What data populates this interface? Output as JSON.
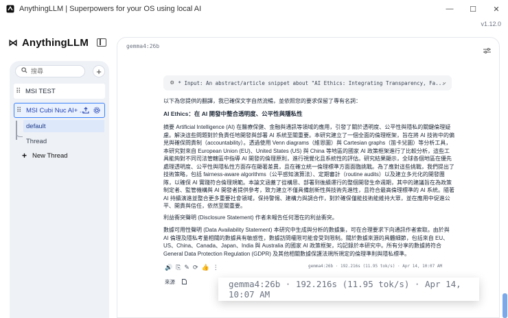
{
  "window": {
    "title": "AnythingLLM | Superpowers for your OS using local AI",
    "minimize": "—",
    "maximize": "☐",
    "close": "✕"
  },
  "version": "v1.12.0",
  "brand": {
    "name": "AnythingLLM",
    "mark": "⋈"
  },
  "sidebar": {
    "search_placeholder": "搜尋",
    "add_label": "+",
    "workspaces": [
      {
        "label": "MSI TEST",
        "grip": "⠿"
      },
      {
        "label": "MSI Cubi Nuc AI+ ...",
        "grip": "⠿"
      }
    ],
    "threads": [
      {
        "label": "default"
      },
      {
        "label": "Thread"
      }
    ],
    "new_thread": "New Thread"
  },
  "main": {
    "model_label": "gemma4:26b",
    "thought_preview": "* Input: An abstract/article snippet about \"AI Ethics: Integrating Transparency, Fa...",
    "response": {
      "intro": "以下為您提供的翻譯，我已確保文字自然流暢，並依照您的要求保留了專有名詞：",
      "heading": "AI Ethics：在 AI 開發中整合透明度、公平性與隱私性",
      "para1": "摘要 Artificial Intelligence (AI) 在醫療保健、金融與通訊等領域的應用，引發了關於透明度、公平性與隱私的關鍵倫理疑慮。解決這些問題對於負責任地開發與部署 AI 系統至關重要。本研究建立了一個全面的倫理框架，旨在將 AI 技術中的偏見與確保問責制（accountability）。透過使用 Venn diagrams（維恩圖）與 Cartesian graphs（笛卡兒圖）等分析工具，本研究對來自 European Union (EU)、United States (US) 與 China 等地區的國家 AI 政策框架進行了比較分析，這些工具能夠對不同司法管轄區中指導 AI 開發的倫理原則，進行視覺化且系統性的評估。研究結果顯示，全球各個地區在優先處理透明度、公平性與隱私性方面存在顯著差異，且在確立統一倫理標準方面面臨挑戰。為了應對這些挑戰，我們提出了技術策略，包括 fairness-aware algorithms（公平感知演算法）、定期審計（routine audits）以及建立多元化的開發團隊，以確保 AI 實踐符合倫理規範。本論文涵蓋了從構思、部署到後續運行的整個開發生命週期，其中的建議旨在為政策制定者、監管機構與 AI 開發者提供參考，致力建立不僅具備創新性與技術先進性，且符合最高倫理標準的 AI 系統。隨著 AI 持續演進並整合更多重要社會領域，保持警惕、建構力與調合作，對於確保僅能技術能維持大眾，並在應用中促進公平、開責與信任，依然至關重要。",
      "para2": "利益衝突聲明 (Disclosure Statement) 作者未報告任何潛在的利益衝突。",
      "para3": "數據可用性聲明 (Data Availability Statement) 本研究中生成與分析的數據集，可在合理要求下向通訊作者索取。由於與 AI 倫理及隱私考量相關的數據具有敏感性，數據訪問權限可能會受到限制。關於數據來源的具體細節，包括來自 EU、US、China、Canada、Japan、India 與 Australia 的國家 AI 政策框架，均記錄於本研究中。所有分享的數據將符合 General Data Protection Regulation (GDPR) 及其他相關數據保護法規所規定的倫理準則與隱私標準。"
    },
    "actions": [
      "🔊",
      "⎘",
      "✎",
      "⟳",
      "👍",
      "⋮"
    ],
    "stats": "gemma4:26b · 192.216s (11.95 tok/s) · Apr 14, 10:07 AM",
    "sources_label": "來源",
    "overlay_stats": "gemma4:26b · 192.216s (11.95 tok/s) · Apr 14, 10:07 AM"
  }
}
